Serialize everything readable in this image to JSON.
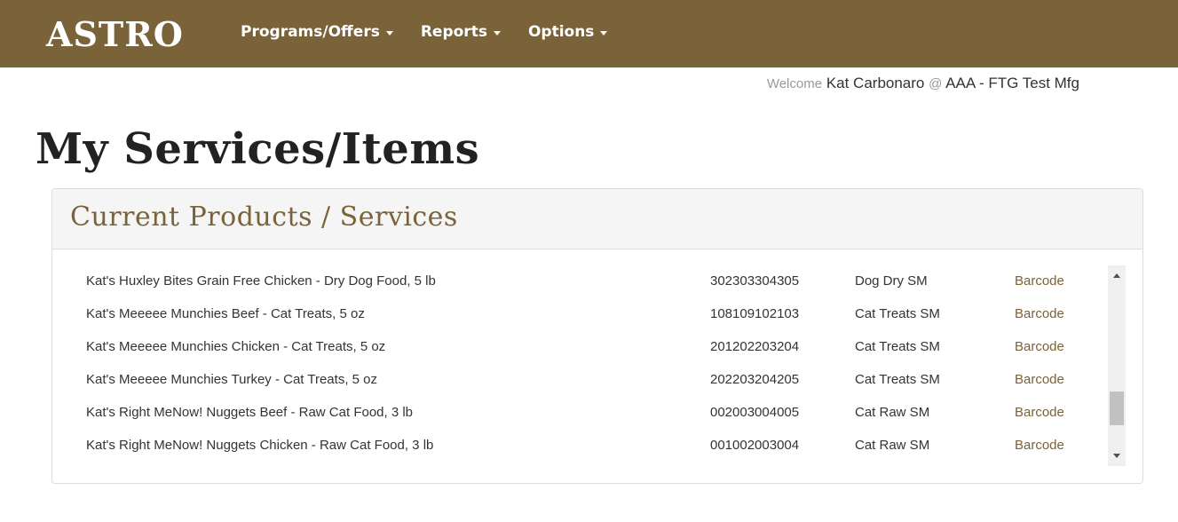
{
  "header": {
    "logo": "ASTRO",
    "nav": [
      {
        "label": "Programs/Offers"
      },
      {
        "label": "Reports"
      },
      {
        "label": "Options"
      }
    ],
    "colors": {
      "navbar": "#7a6239",
      "accent": "#7a6239"
    }
  },
  "welcome": {
    "prefix": "Welcome",
    "user": "Kat Carbonaro",
    "at": "@",
    "company": "AAA - FTG Test Mfg"
  },
  "page_title": "My Services/Items",
  "panel": {
    "title": "Current Products / Services",
    "rows": [
      {
        "name": "Kat's Huxley Bites Grain Free Chicken - Dry Dog Food, 5 lb",
        "code": "302303304305",
        "category": "Dog Dry SM",
        "link": "Barcode"
      },
      {
        "name": "Kat's Meeeee Munchies Beef - Cat Treats, 5 oz",
        "code": "108109102103",
        "category": "Cat Treats SM",
        "link": "Barcode"
      },
      {
        "name": "Kat's Meeeee Munchies Chicken - Cat Treats, 5 oz",
        "code": "201202203204",
        "category": "Cat Treats SM",
        "link": "Barcode"
      },
      {
        "name": "Kat's Meeeee Munchies Turkey - Cat Treats, 5 oz",
        "code": "202203204205",
        "category": "Cat Treats SM",
        "link": "Barcode"
      },
      {
        "name": "Kat's Right MeNow! Nuggets Beef - Raw Cat Food, 3 lb",
        "code": "002003004005",
        "category": "Cat Raw SM",
        "link": "Barcode"
      },
      {
        "name": "Kat's Right MeNow! Nuggets Chicken - Raw Cat Food, 3 lb",
        "code": "001002003004",
        "category": "Cat Raw SM",
        "link": "Barcode"
      }
    ]
  }
}
